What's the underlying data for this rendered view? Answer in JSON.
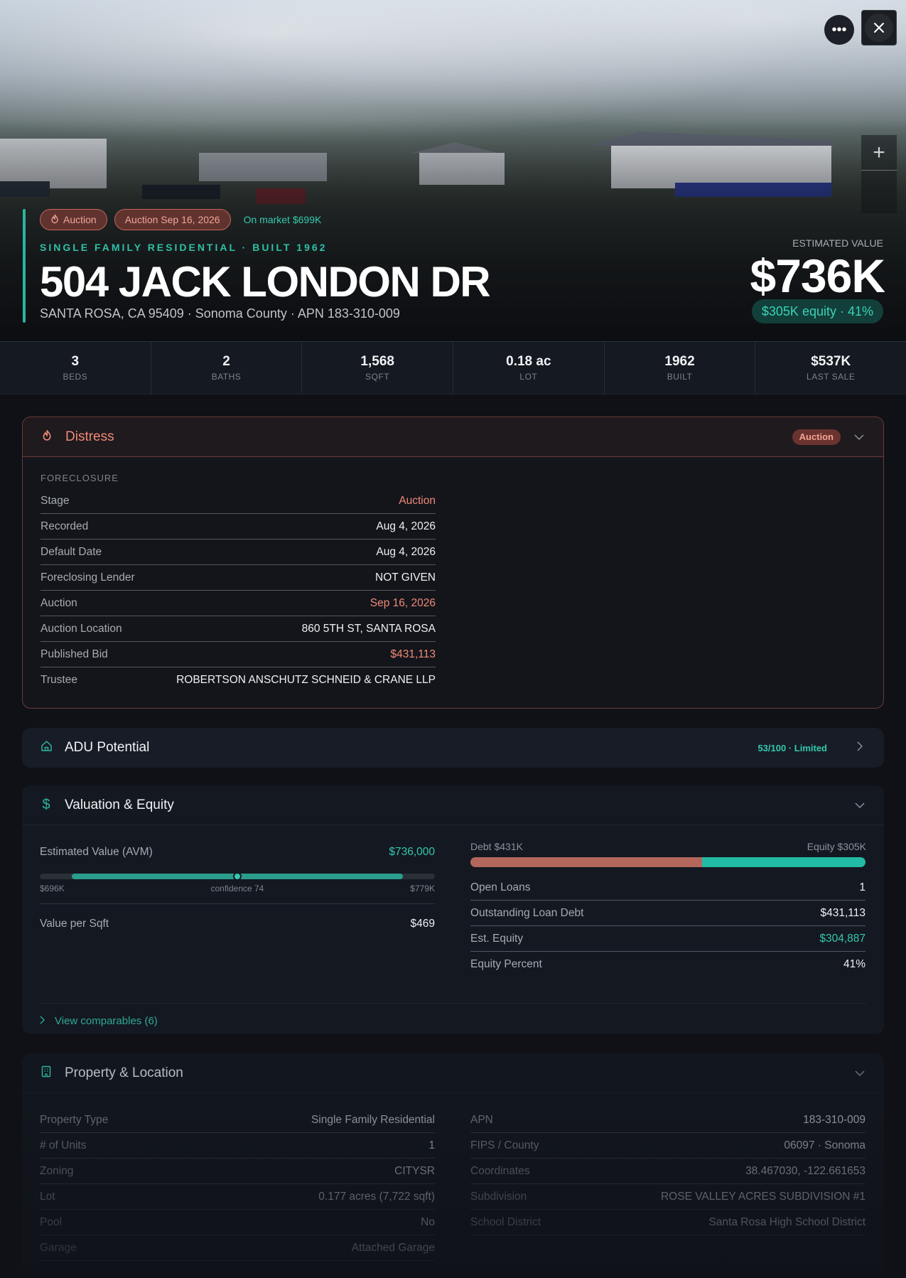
{
  "hero": {
    "chips": {
      "auction": "Auction",
      "auction_date": "Auction Sep 16, 2026",
      "on_market": "On market $699K"
    },
    "eyebrow": "SINGLE FAMILY RESIDENTIAL · BUILT 1962",
    "title": "504 JACK LONDON DR",
    "subtitle": "SANTA ROSA, CA 95409 · Sonoma County · APN 183-310-009",
    "estimated_label": "ESTIMATED VALUE",
    "estimated_value": "$736K",
    "equity_pill": "$305K equity · 41%"
  },
  "stats": [
    {
      "value": "3",
      "label": "BEDS"
    },
    {
      "value": "2",
      "label": "BATHS"
    },
    {
      "value": "1,568",
      "label": "SQFT"
    },
    {
      "value": "0.18 ac",
      "label": "LOT"
    },
    {
      "value": "1962",
      "label": "BUILT"
    },
    {
      "value": "$537K",
      "label": "LAST SALE"
    }
  ],
  "distress": {
    "title": "Distress",
    "badge": "Auction",
    "section_label": "FORECLOSURE",
    "rows": [
      {
        "k": "Stage",
        "v": "Auction"
      },
      {
        "k": "Recorded",
        "v": "Aug 4, 2026"
      },
      {
        "k": "Default Date",
        "v": "Aug 4, 2026"
      },
      {
        "k": "Foreclosing Lender",
        "v": "NOT GIVEN"
      },
      {
        "k": "Auction",
        "v": "Sep 16, 2026"
      },
      {
        "k": "Auction Location",
        "v": "860 5TH ST, SANTA ROSA"
      },
      {
        "k": "Published Bid",
        "v": "$431,113"
      },
      {
        "k": "Trustee",
        "v": "ROBERTSON ANSCHUTZ SCHNEID & CRANE LLP"
      }
    ]
  },
  "adu": {
    "title": "ADU Potential",
    "score": "53/100 · Limited"
  },
  "valuation": {
    "title": "Valuation & Equity",
    "avm_label": "Estimated Value (AVM)",
    "avm_value": "$736,000",
    "range_low": "$696K",
    "range_high": "$779K",
    "confidence": "confidence 74",
    "vps_label": "Value per Sqft",
    "vps_value": "$469",
    "debt_label": "Debt $431K",
    "equity_label": "Equity $305K",
    "debt_fraction": 0.586,
    "rows": [
      {
        "k": "Open Loans",
        "v": "1"
      },
      {
        "k": "Outstanding Loan Debt",
        "v": "$431,113"
      },
      {
        "k": "Est. Equity",
        "v": "$304,887"
      },
      {
        "k": "Equity Percent",
        "v": "41%"
      }
    ],
    "comps": "View comparables (6)"
  },
  "property": {
    "title": "Property & Location",
    "left": [
      {
        "k": "Property Type",
        "v": "Single Family Residential"
      },
      {
        "k": "# of Units",
        "v": "1"
      },
      {
        "k": "Zoning",
        "v": "CITYSR"
      },
      {
        "k": "Lot",
        "v": "0.177 acres (7,722 sqft)"
      },
      {
        "k": "Pool",
        "v": "No"
      },
      {
        "k": "Garage",
        "v": "Attached Garage"
      }
    ],
    "right": [
      {
        "k": "APN",
        "v": "183-310-009"
      },
      {
        "k": "FIPS / County",
        "v": "06097 · Sonoma"
      },
      {
        "k": "Coordinates",
        "v": "38.467030, -122.661653"
      },
      {
        "k": "Subdivision",
        "v": "ROSE VALLEY ACRES SUBDIVISION #1"
      },
      {
        "k": "School District",
        "v": "Santa Rosa High School District"
      }
    ]
  },
  "colors": {
    "accent_teal": "#2bb5a0",
    "distress_red": "#f08a78",
    "background": "#0f1117"
  }
}
